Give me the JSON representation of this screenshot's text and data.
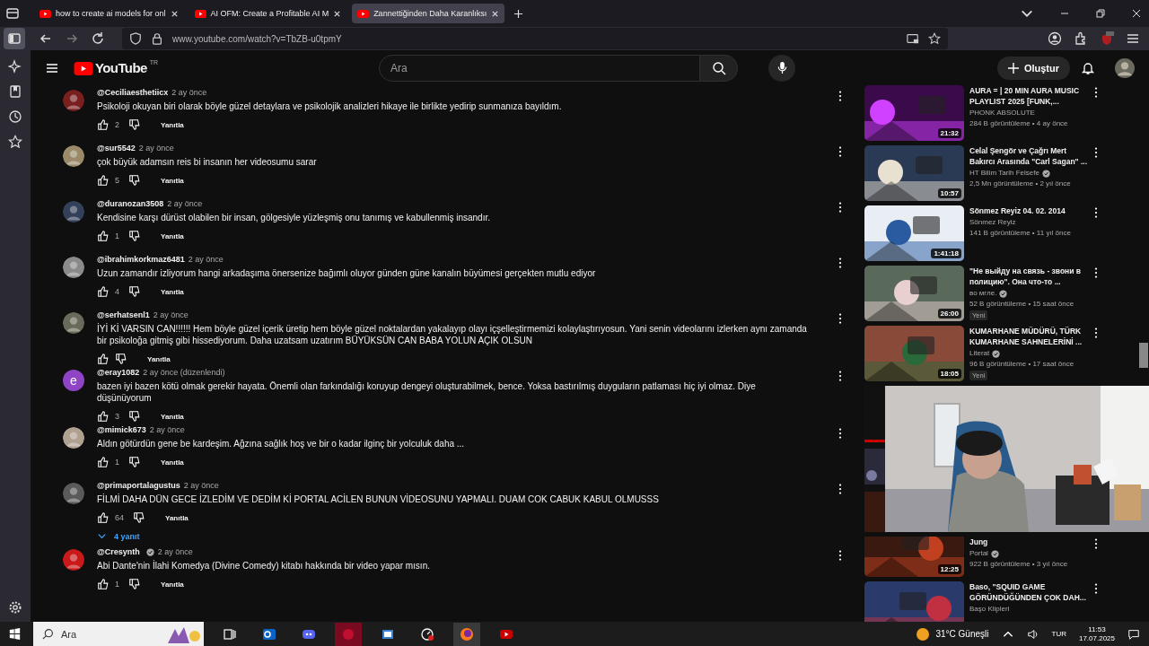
{
  "browser": {
    "tabs": [
      {
        "title": "how to create ai models for onl",
        "selected": false
      },
      {
        "title": "AI OFM: Create a Profitable AI M",
        "selected": false
      },
      {
        "title": "Zannettiğinden Daha Karanlıksı",
        "selected": true
      }
    ],
    "url": "www.youtube.com/watch?v=TbZB-u0tpmY",
    "sidebar": [
      {
        "kind": "panel",
        "selected": true
      },
      {
        "kind": "sparkle",
        "selected": false
      },
      {
        "kind": "bookmark",
        "selected": false
      },
      {
        "kind": "history",
        "selected": false
      },
      {
        "kind": "star",
        "selected": false
      }
    ]
  },
  "youtube": {
    "logo": "YouTube",
    "region": "TR",
    "search": {
      "placeholder": "Ara"
    },
    "create_button": "Oluştur",
    "comments": [
      {
        "author": "@Ceciliaesthetiicx",
        "verified": false,
        "time": "2 ay önce",
        "text": "Psikoloji okuyan biri olarak böyle güzel detaylara ve psikolojik analizleri hikaye ile birlikte yedirip sunmanıza bayıldım.",
        "likes": "2",
        "reply": "Yanıtla"
      },
      {
        "author": "@sur5542",
        "verified": false,
        "time": "2 ay önce",
        "text": "çok büyük adamsın reis bi insanın her videosumu sarar",
        "likes": "5",
        "reply": "Yanıtla"
      },
      {
        "author": "@duranozan3508",
        "verified": false,
        "time": "2 ay önce",
        "text": "Kendisine karşı dürüst olabilen bir insan, gölgesiyle yüzleşmiş onu tanımış ve kabullenmiş insandır.",
        "likes": "1",
        "reply": "Yanıtla"
      },
      {
        "author": "@ibrahimkorkmaz6481",
        "verified": false,
        "time": "2 ay önce",
        "text": "Uzun zamandır izliyorum hangi arkadaşıma önersenize bağımlı oluyor günden güne kanalın büyümesi gerçekten mutlu ediyor",
        "likes": "4",
        "reply": "Yanıtla"
      },
      {
        "author": "@serhatsenl1",
        "verified": false,
        "time": "2 ay önce",
        "text": "İYİ Kİ VARSIN CAN!!!!!! Hem böyle güzel içerik üretip hem böyle güzel noktalardan yakalayıp olayı içşelleştirmemizi kolaylaştırıyosun. Yani senin videolarını  izlerken aynı zamanda bir psikoloğa gitmiş gibi hissediyorum. Daha uzatsam uzatırım BÜYÜKSÜN CAN BABA YOLUN AÇIK OLSUN",
        "reply": "Yanıtla"
      },
      {
        "author": "@eray1082",
        "verified": false,
        "time": "2 ay önce (düzenlendi)",
        "avatar_letter": "e",
        "text": "bazen iyi bazen kötü olmak gerekir hayata. Önemli olan farkındalığı koruyup dengeyi oluşturabilmek, bence. Yoksa bastırılmış duyguların patlaması hiç iyi olmaz. Diye düşünüyorum",
        "likes": "3",
        "reply": "Yanıtla"
      },
      {
        "author": "@mimick673",
        "verified": false,
        "time": "2 ay önce",
        "text": "Aldın götürdün gene be kardeşim. Ağzına sağlık hoş ve bir o kadar ilginç bir yolculuk daha ...",
        "likes": "1",
        "reply": "Yanıtla"
      },
      {
        "author": "@primaportalagustus",
        "verified": false,
        "time": "2 ay önce",
        "text": "FİLMİ DAHA DÜN GECE İZLEDİM VE DEDİM Kİ PORTAL ACİLEN BUNUN VİDEOSUNU YAPMALI. DUAM COK CABUK KABUL OLMUSSS",
        "likes": "64",
        "reply": "Yanıtla",
        "replies": "4 yanıt"
      },
      {
        "author": "@Cresynth",
        "verified": true,
        "time": "2 ay önce",
        "text": "Abi Dante'nin İlahi Komedya (Divine Comedy) kitabı hakkında bir video yapar mısın.",
        "likes": "1",
        "reply": "Yanıtla"
      }
    ],
    "recommendations": [
      {
        "kind": "video",
        "title": "AURA = | 20 MIN AURA MUSIC PLAYLIST 2025 [FUNK,...",
        "channel": "PHONK ABSOLUTE",
        "verified": false,
        "meta": "284 B görüntüleme • 4 ay önce",
        "duration": "21:32"
      },
      {
        "kind": "video",
        "title": "Celal Şengör ve Çağrı Mert Bakırcı Arasında \"Carl Sagan\" ...",
        "channel": "HT Bilim Tarih Felsefe",
        "verified": true,
        "meta": "2,5 Mn görüntüleme • 2 yıl önce",
        "duration": "10:57"
      },
      {
        "kind": "video",
        "title": "Sönmez Reyiz 04. 02. 2014",
        "channel": "Sönmez Reyiz",
        "verified": false,
        "meta": "141 B görüntüleme • 11 yıl önce",
        "duration": "1:41:18"
      },
      {
        "kind": "video",
        "title": "\"Не выйду на связь - звони в полицию\". Она что-то ...",
        "channel": "во мгле.",
        "verified": true,
        "meta": "52 B görüntüleme • 15 saat önce",
        "badge": "Yeni",
        "duration": "26:00"
      },
      {
        "kind": "video",
        "title": "KUMARHANE MÜDÜRÜ, TÜRK KUMARHANE SAHNELERİNİ ...",
        "channel": "Literat",
        "verified": true,
        "meta": "96 B görüntüleme • 17 saat önce",
        "badge": "Yeni",
        "duration": "18:05"
      },
      {
        "kind": "hidden"
      },
      {
        "kind": "partial",
        "title": "Jung",
        "channel": "Portal",
        "verified": true,
        "meta": "922 B görüntüleme • 3 yıl önce",
        "duration": "12:25"
      },
      {
        "kind": "video",
        "title": "Baso, \"SQUID GAME GÖRÜNDÜĞÜNDEN ÇOK DAH...",
        "channel": "Başo Klipleri",
        "verified": false
      }
    ]
  },
  "taskbar": {
    "search_placeholder": "Ara",
    "weather": "31°C Güneşli",
    "language": "TUR",
    "time": "11:53",
    "date": "17.07.2025"
  }
}
